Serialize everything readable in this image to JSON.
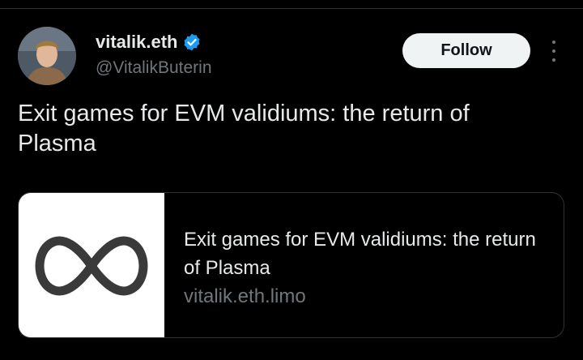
{
  "author": {
    "display_name": "vitalik.eth",
    "handle": "@VitalikButerin",
    "verified": true
  },
  "follow_button": {
    "label": "Follow"
  },
  "tweet": {
    "text": "Exit games for EVM validiums: the return of Plasma"
  },
  "link_card": {
    "title": "Exit games for EVM validiums: the return of Plasma",
    "domain": "vitalik.eth.limo",
    "thumbnail_icon": "infinity-icon"
  },
  "colors": {
    "background": "#000000",
    "text_primary": "#e7e9ea",
    "text_secondary": "#71767b",
    "verified_badge": "#1d9bf0",
    "follow_button_bg": "#eff3f4"
  }
}
